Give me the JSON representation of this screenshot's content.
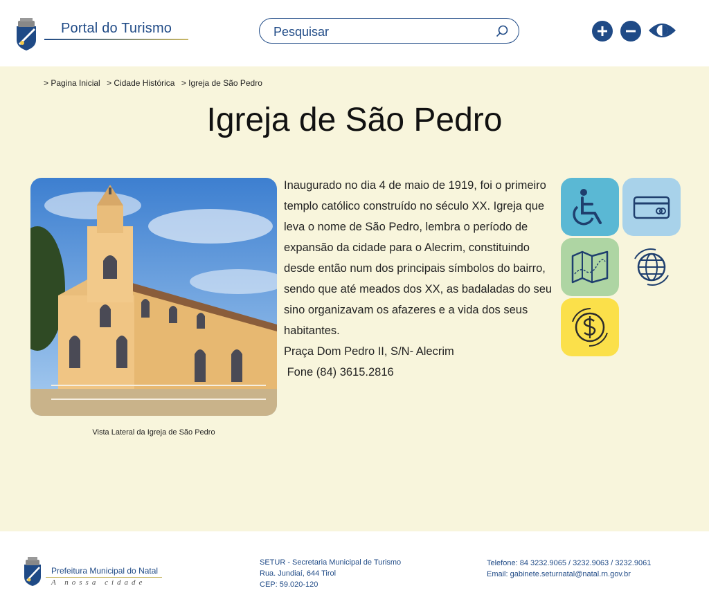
{
  "header": {
    "portal_title": "Portal do Turismo",
    "search_placeholder": "Pesquisar"
  },
  "accessibility": {
    "increase_font": "+",
    "decrease_font": "−"
  },
  "breadcrumb": [
    "> Pagina Inicial",
    "> Cidade Histórica",
    "> Igreja de São Pedro"
  ],
  "page_title": "Igreja de São Pedro",
  "photo": {
    "caption": "Vista Lateral da Igreja de São Pedro"
  },
  "description": {
    "text": "Inaugurado no dia 4 de maio de 1919, foi o primeiro templo católico construído no século XX. Igreja que leva o nome de São Pedro, lembra o período de expansão da cidade para o Alecrim, constituindo desde então num dos principais símbolos do bairro, sendo que até meados dos XX, as badaladas do seu sino organizavam os afazeres e a vida dos seus habitantes.",
    "address": "Praça Dom Pedro II, S/N- Alecrim",
    "phone": " Fone (84) 3615.2816"
  },
  "amenities": [
    {
      "icon": "wheelchair-icon",
      "color": "#5ab8d4"
    },
    {
      "icon": "credit-card-icon",
      "color": "#a8d2ea"
    },
    {
      "icon": "map-icon",
      "color": "#aed5a3"
    },
    {
      "icon": "globe-icon",
      "color": "transparent"
    },
    {
      "icon": "money-icon",
      "color": "#fbe04a"
    }
  ],
  "footer": {
    "org_name": "Prefeitura Municipal do Natal",
    "tagline": "A nossa cidade",
    "address_lines": [
      "SETUR - Secretaria Municipal de Turismo",
      "Rua. Jundiaí, 644 Tirol",
      "CEP: 59.020-120"
    ],
    "contact_lines": [
      "Telefone: 84 3232.9065 / 3232.9063 / 3232.9061",
      "Email: gabinete.seturnatal@natal.rn.gov.br"
    ]
  },
  "colors": {
    "brand_blue": "#1f4a86",
    "page_background": "#f8f5dc",
    "accent_gold": "#c9b765"
  }
}
